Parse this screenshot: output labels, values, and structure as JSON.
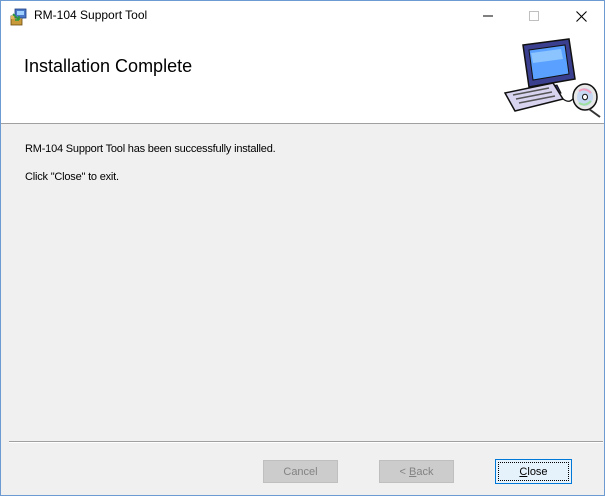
{
  "window": {
    "title": "RM-104 Support Tool",
    "controls": {
      "minimize": "—",
      "maximize": "☐",
      "close": "✕"
    }
  },
  "header": {
    "title": "Installation Complete",
    "art_icon": "computer-with-disc-icon"
  },
  "body": {
    "message_line1": "RM-104 Support Tool has been successfully installed.",
    "message_line2": "Click \"Close\" to exit."
  },
  "buttons": {
    "cancel": {
      "label": "Cancel",
      "enabled": false
    },
    "back": {
      "prefix": "< ",
      "mnemonic": "B",
      "rest": "ack",
      "enabled": false
    },
    "close": {
      "mnemonic": "C",
      "rest": "lose",
      "enabled": true,
      "focused": true
    }
  },
  "colors": {
    "window_border": "#6d9bd1",
    "focus_border": "#0078d7",
    "dialog_bg": "#f0f0f0"
  }
}
